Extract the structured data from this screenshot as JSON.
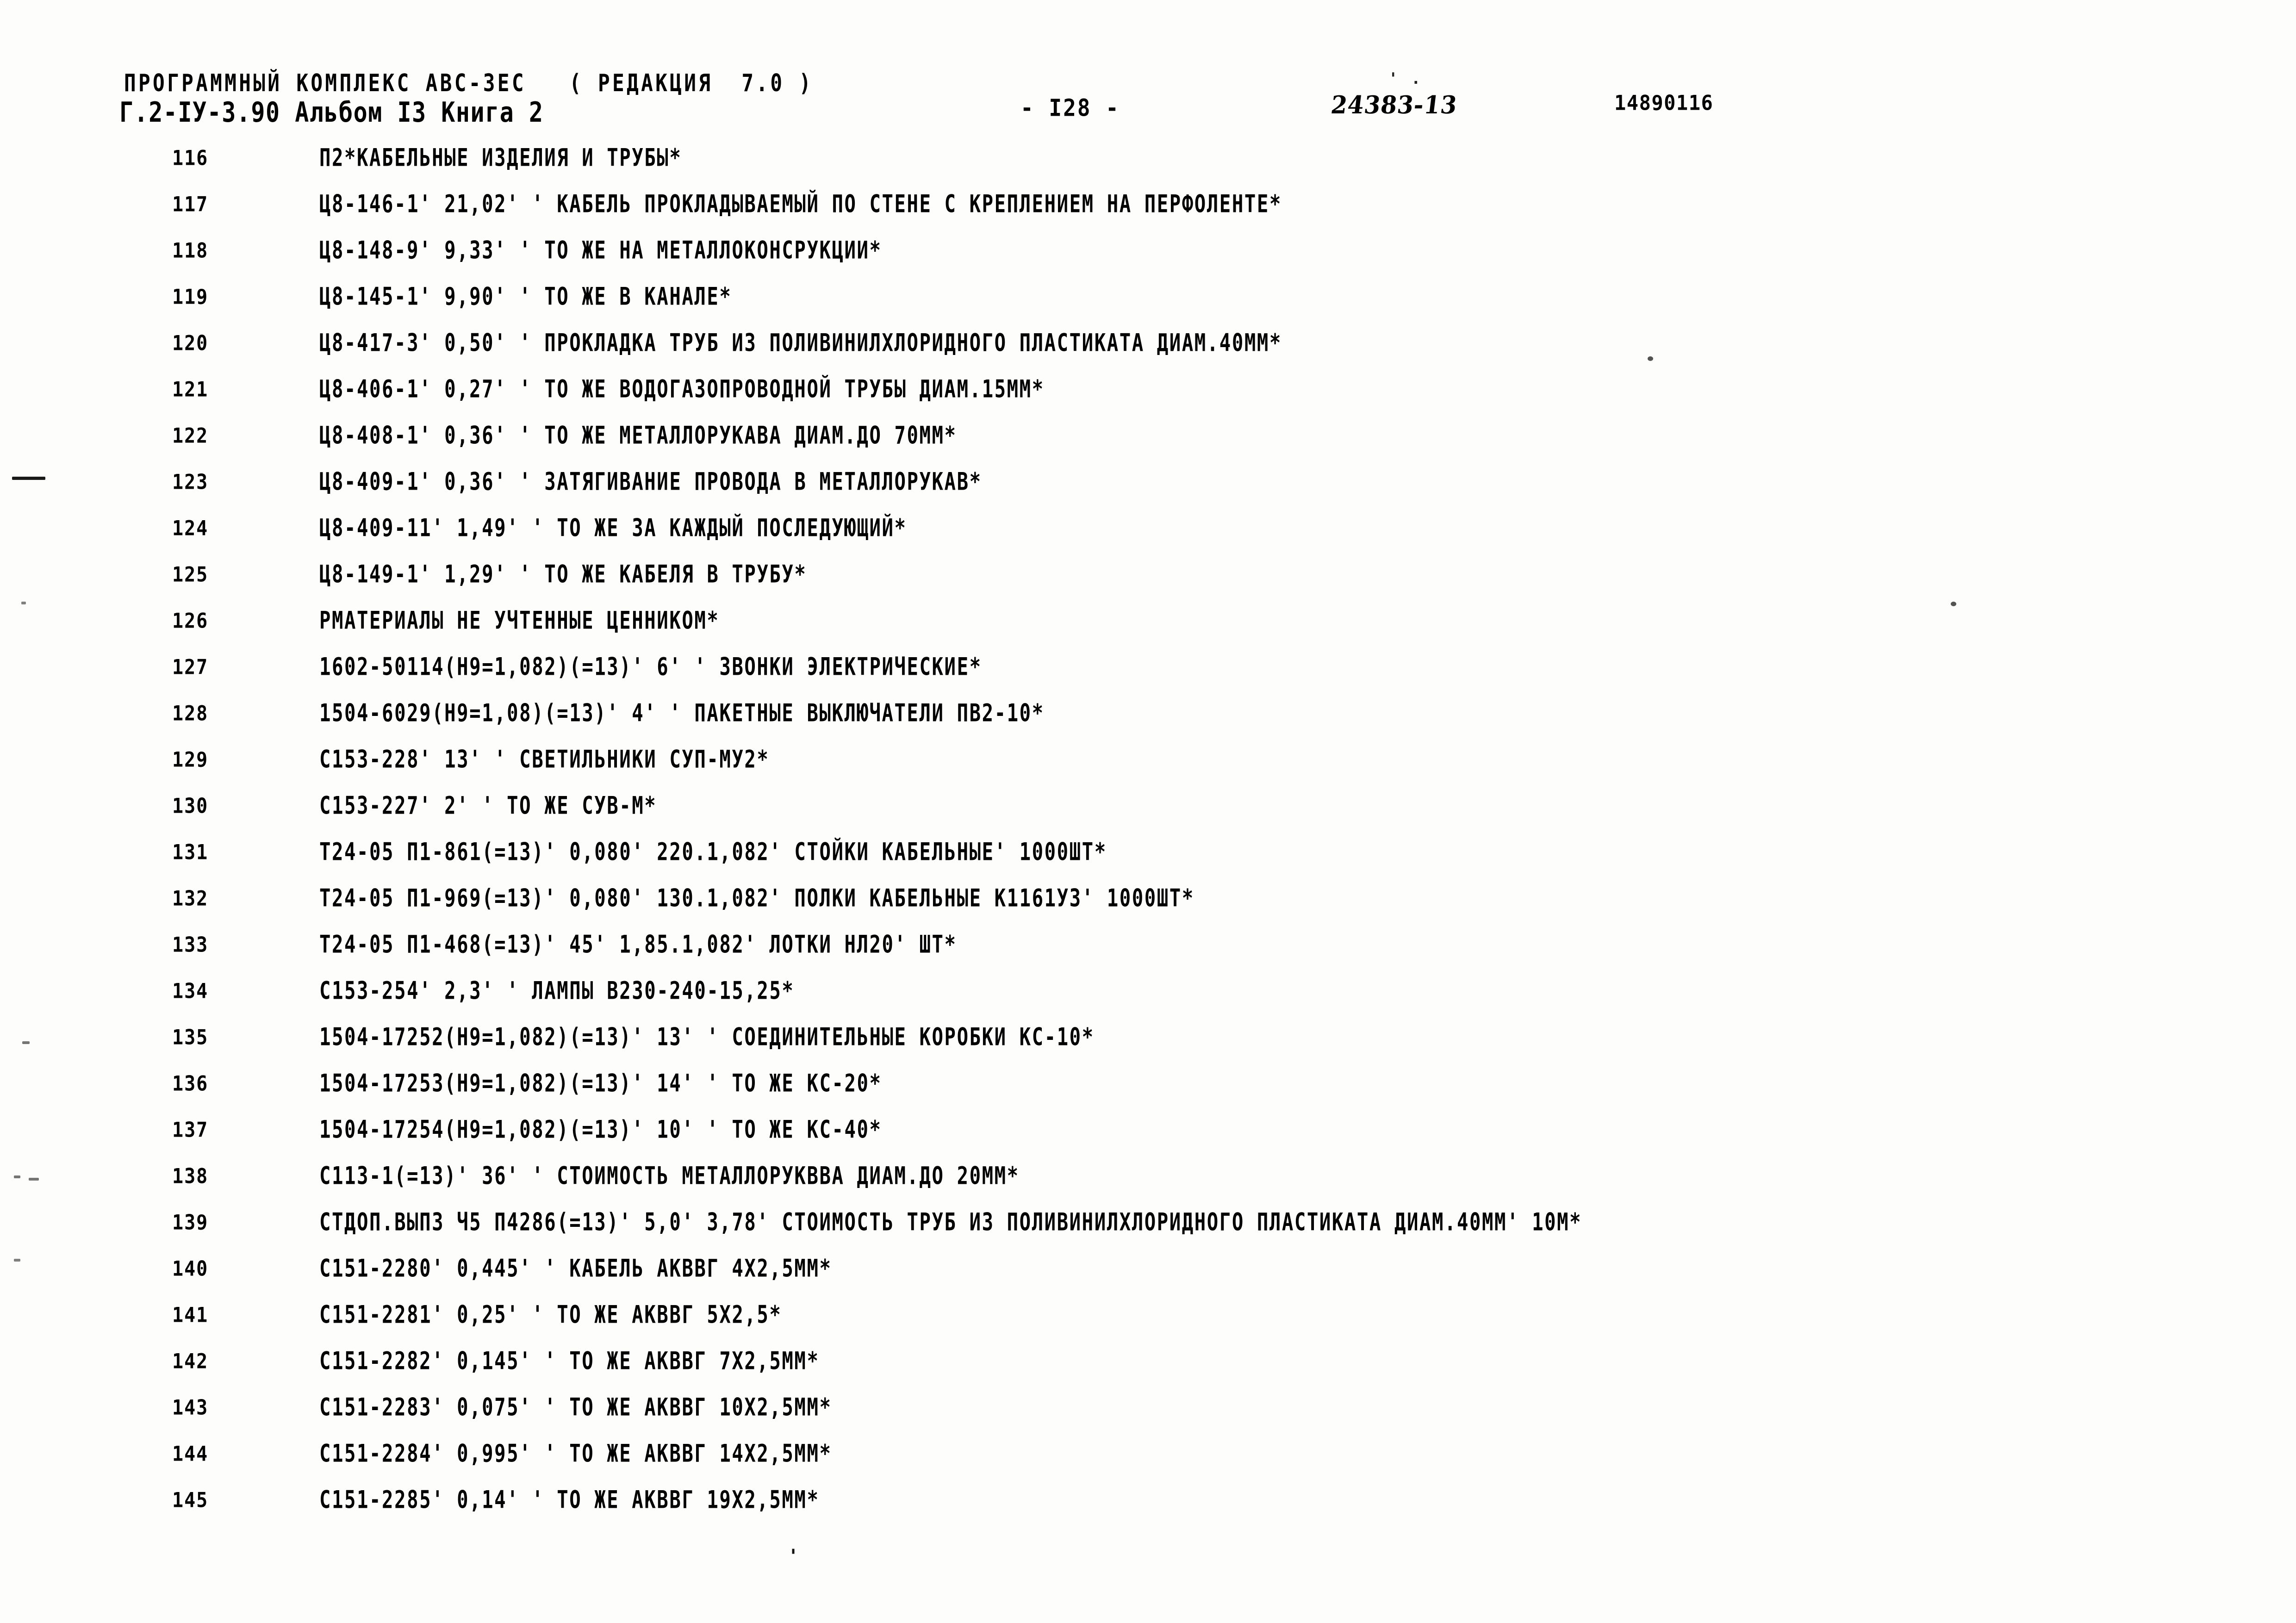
{
  "header": {
    "program_line": "ПРОГРАММНЫЙ КОМПЛЕКС АВС-ЗЕС   ( РЕДАКЦИЯ  7.0 )",
    "document_line": "Г.2-IУ-3.90 Альбом I3 Книга 2",
    "page_number": "- I28 -",
    "handwritten_stamp": "24383-13",
    "stamp_dots": "' .",
    "code_number": "14890116"
  },
  "footer": {
    "tick_mark": "'"
  },
  "listing": {
    "rows": [
      {
        "num": "116",
        "text": "П2*КАБЕЛЬНЫЕ ИЗДЕЛИЯ И ТРУБЫ*"
      },
      {
        "num": "117",
        "text": "Ц8-146-1' 21,02' ' КАБЕЛЬ ПРОКЛАДЫВАЕМЫЙ ПО СТЕНЕ С КРЕПЛЕНИЕМ НА ПЕРФОЛЕНТЕ*"
      },
      {
        "num": "118",
        "text": "Ц8-148-9' 9,33' ' ТО ЖЕ НА МЕТАЛЛОКОНСРУКЦИИ*"
      },
      {
        "num": "119",
        "text": "Ц8-145-1' 9,90' ' ТО ЖЕ В КАНАЛЕ*"
      },
      {
        "num": "120",
        "text": "Ц8-417-3' 0,50' ' ПРОКЛАДКА ТРУБ ИЗ ПОЛИВИНИЛХЛОРИДНОГО ПЛАСТИКАТА ДИАМ.40ММ*"
      },
      {
        "num": "121",
        "text": "Ц8-406-1' 0,27' ' ТО ЖЕ ВОДОГАЗОПРОВОДНОЙ ТРУБЫ ДИАМ.15ММ*"
      },
      {
        "num": "122",
        "text": "Ц8-408-1' 0,36' ' ТО ЖЕ МЕТАЛЛОРУКАВА ДИАМ.ДО 70ММ*"
      },
      {
        "num": "123",
        "text": "Ц8-409-1' 0,36' ' ЗАТЯГИВАНИЕ ПРОВОДА В МЕТАЛЛОРУКАВ*"
      },
      {
        "num": "124",
        "text": "Ц8-409-11' 1,49' ' ТО ЖЕ ЗА КАЖДЫЙ ПОСЛЕДУЮЩИЙ*"
      },
      {
        "num": "125",
        "text": "Ц8-149-1' 1,29' ' ТО ЖЕ КАБЕЛЯ В ТРУБУ*"
      },
      {
        "num": "126",
        "text": "РМАТЕРИАЛЫ НЕ УЧТЕННЫЕ ЦЕННИКОМ*"
      },
      {
        "num": "127",
        "text": "1602-50114(Н9=1,082)(=13)' 6' ' ЗВОНКИ ЭЛЕКТРИЧЕСКИЕ*"
      },
      {
        "num": "128",
        "text": "1504-6029(Н9=1,08)(=13)' 4' ' ПАКЕТНЫЕ ВЫКЛЮЧАТЕЛИ ПВ2-10*"
      },
      {
        "num": "129",
        "text": "С153-228' 13' ' СВЕТИЛЬНИКИ СУП-МУ2*"
      },
      {
        "num": "130",
        "text": "С153-227' 2' ' ТО ЖЕ СУВ-М*"
      },
      {
        "num": "131",
        "text": "Т24-05 П1-861(=13)' 0,080' 220.1,082' СТОЙКИ КАБЕЛЬНЫЕ' 1000ШТ*"
      },
      {
        "num": "132",
        "text": "Т24-05 П1-969(=13)' 0,080' 130.1,082' ПОЛКИ КАБЕЛЬНЫЕ К1161У3' 1000ШТ*"
      },
      {
        "num": "133",
        "text": "Т24-05 П1-468(=13)' 45' 1,85.1,082' ЛОТКИ НЛ20' ШТ*"
      },
      {
        "num": "134",
        "text": "С153-254' 2,3' ' ЛАМПЫ В230-240-15,25*"
      },
      {
        "num": "135",
        "text": "1504-17252(Н9=1,082)(=13)' 13' ' СОЕДИНИТЕЛЬНЫЕ КОРОБКИ КС-10*"
      },
      {
        "num": "136",
        "text": "1504-17253(Н9=1,082)(=13)' 14' ' ТО ЖЕ КС-20*"
      },
      {
        "num": "137",
        "text": "1504-17254(Н9=1,082)(=13)' 10' ' ТО ЖЕ КС-40*"
      },
      {
        "num": "138",
        "text": "С113-1(=13)' 36' ' СТОИМОСТЬ МЕТАЛЛОРУКВВА ДИАМ.ДО 20ММ*"
      },
      {
        "num": "139",
        "text": "СТДОП.ВЫП3 Ч5 П4286(=13)' 5,0' 3,78' СТОИМОСТЬ ТРУБ ИЗ ПОЛИВИНИЛХЛОРИДНОГО ПЛАСТИКАТА ДИАМ.40ММ' 10М*"
      },
      {
        "num": "140",
        "text": "С151-2280' 0,445' ' КАБЕЛЬ АКВВГ 4Х2,5ММ*"
      },
      {
        "num": "141",
        "text": "С151-2281' 0,25' ' ТО ЖЕ АКВВГ 5Х2,5*"
      },
      {
        "num": "142",
        "text": "С151-2282' 0,145' ' ТО ЖЕ АКВВГ 7Х2,5ММ*"
      },
      {
        "num": "143",
        "text": "С151-2283' 0,075' ' ТО ЖЕ АКВВГ 10Х2,5ММ*"
      },
      {
        "num": "144",
        "text": "С151-2284' 0,995' ' ТО ЖЕ АКВВГ 14Х2,5ММ*"
      },
      {
        "num": "145",
        "text": "С151-2285' 0,14' ' ТО ЖЕ АКВВГ 19Х2,5ММ*"
      }
    ]
  }
}
